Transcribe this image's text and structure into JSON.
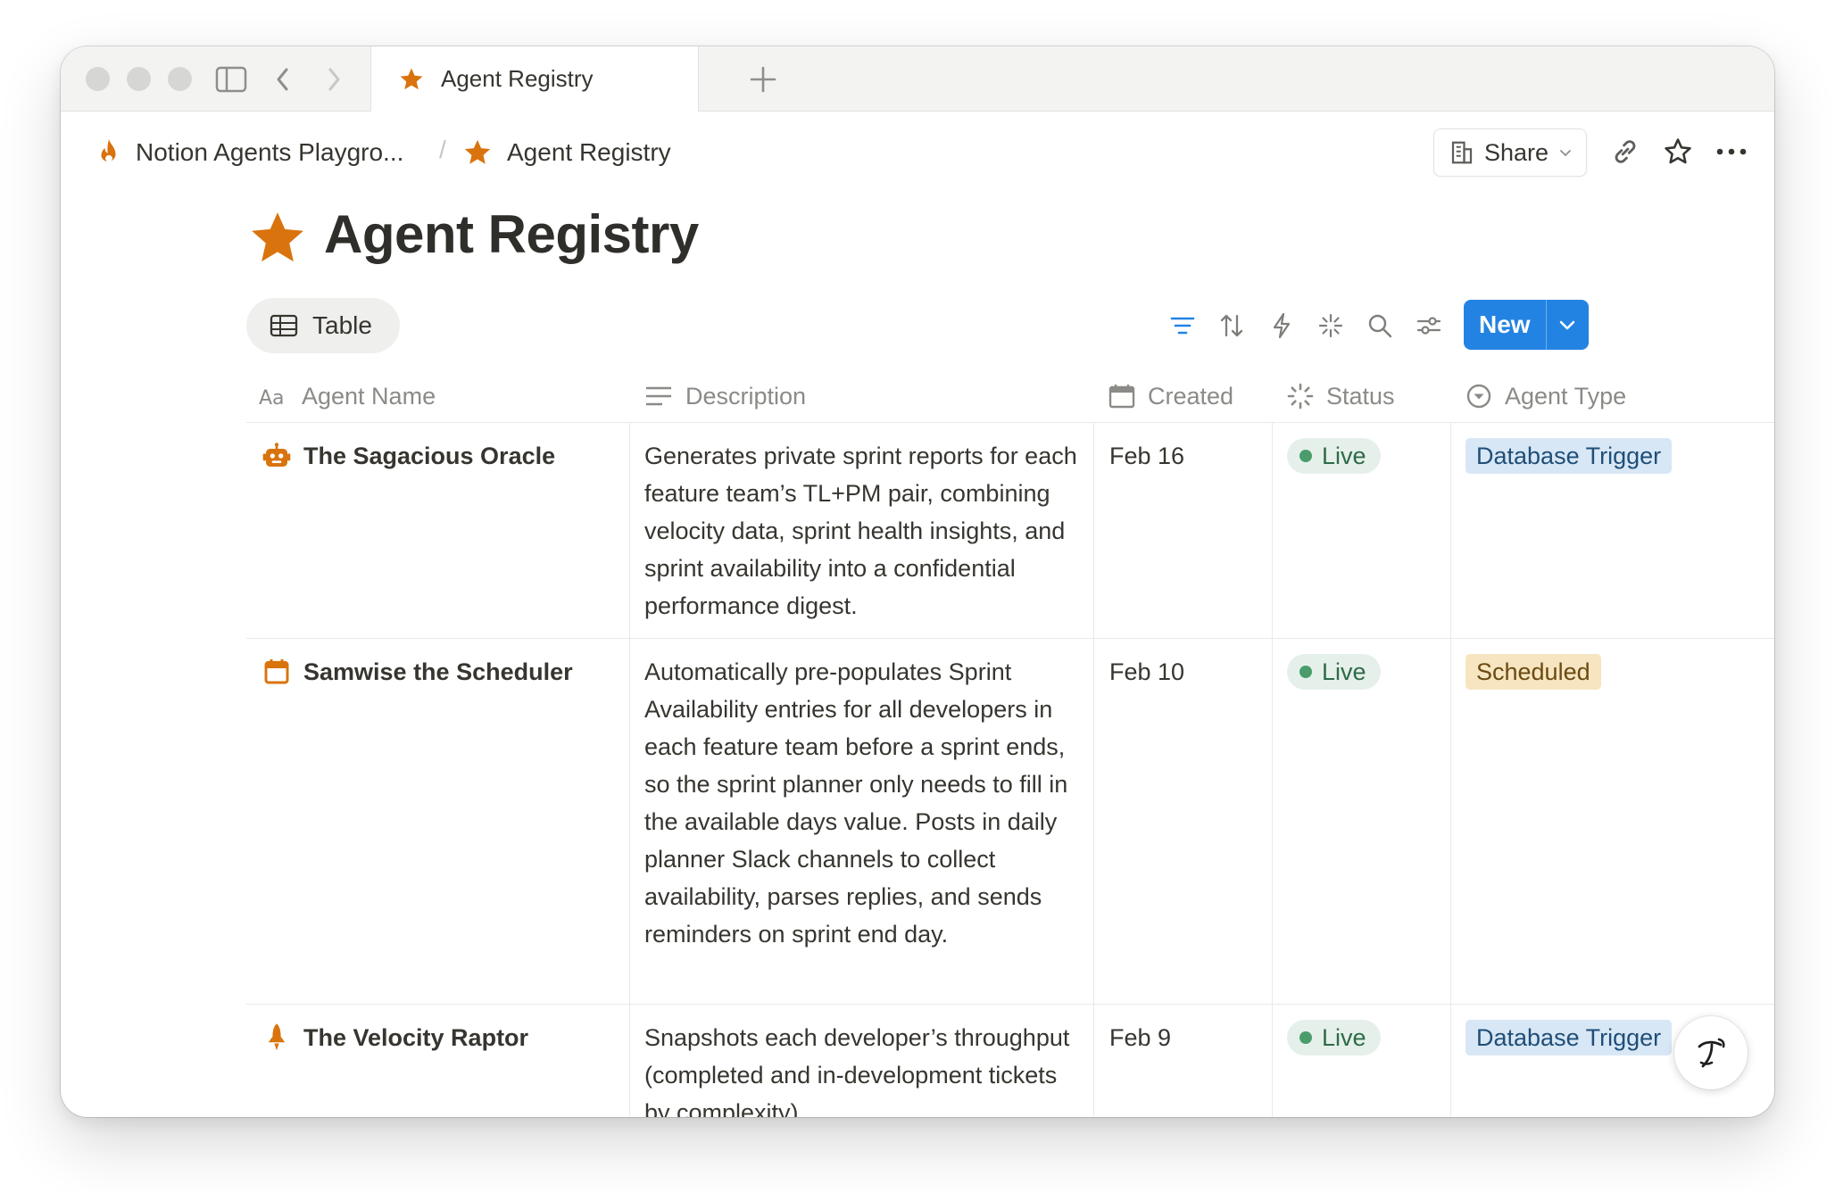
{
  "browser": {
    "tab_title": "Agent Registry",
    "new_tab_symbol": "+"
  },
  "breadcrumb": {
    "workspace": "Notion Agents Playgro...",
    "separator": "/",
    "page": "Agent Registry"
  },
  "topbar": {
    "share_label": "Share"
  },
  "page": {
    "title": "Agent Registry",
    "icon": "star-icon",
    "accent_color": "#d9730d"
  },
  "view": {
    "tab_label": "Table",
    "new_label": "New",
    "new_color": "#2383e2"
  },
  "table": {
    "columns": [
      {
        "label": "Agent Name",
        "icon": "text-type-icon"
      },
      {
        "label": "Description",
        "icon": "lines-icon"
      },
      {
        "label": "Created",
        "icon": "calendar-icon"
      },
      {
        "label": "Status",
        "icon": "status-icon"
      },
      {
        "label": "Agent Type",
        "icon": "select-icon"
      }
    ],
    "rows": [
      {
        "icon": "robot-icon",
        "name": "The Sagacious Oracle",
        "description": "Generates private sprint reports for each feature team’s TL+PM pair, combining velocity data, sprint health insights, and sprint availability into a confidential performance digest.",
        "created": "Feb 16",
        "status": "Live",
        "agent_type": "Database Trigger"
      },
      {
        "icon": "calendar-icon",
        "name": "Samwise the Scheduler",
        "description": "Automatically pre-populates Sprint Availability entries for all developers in each feature team before a sprint ends, so the sprint planner only needs to fill in the available days value. Posts in daily planner Slack channels to collect availability, parses replies, and sends reminders on sprint end day.",
        "created": "Feb 10",
        "status": "Live",
        "agent_type": "Scheduled"
      },
      {
        "icon": "rocket-icon",
        "name": "The Velocity Raptor",
        "description": "Snapshots each developer’s throughput (completed and in-development tickets by complexity)",
        "created": "Feb 9",
        "status": "Live",
        "agent_type": "Database Trigger"
      }
    ]
  }
}
